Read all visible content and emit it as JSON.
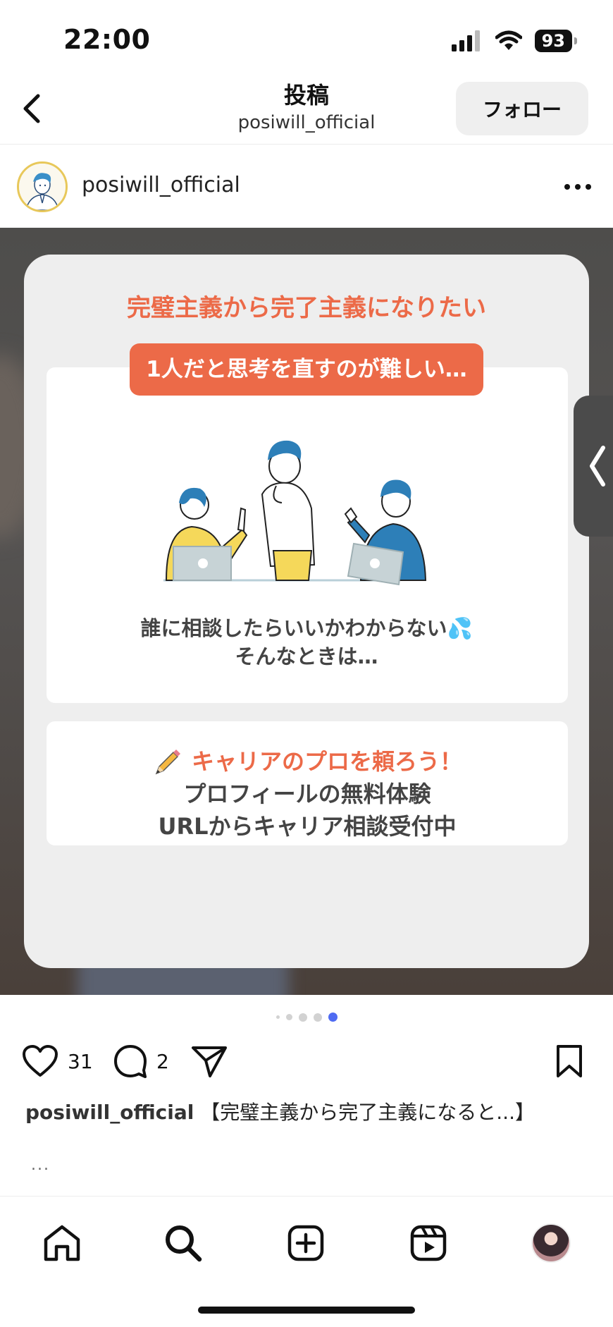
{
  "status_bar": {
    "time": "22:00",
    "battery": "93"
  },
  "header": {
    "title": "投稿",
    "subtitle": "posiwill_official",
    "follow_label": "フォロー"
  },
  "author": {
    "username": "posiwill_official"
  },
  "post": {
    "card_title": "完璧主義から完了主義になりたい",
    "pill_text": "1人だと思考を直すのが難しい…",
    "caption_line1": "誰に相談したらいいかわからない💦",
    "caption_line2": "そんなときは…",
    "cta_line1": "キャリアのプロを頼ろう！",
    "cta_line2": "プロフィールの無料体験",
    "cta_line3": "URLからキャリア相談受付中",
    "carousel_total": 5,
    "carousel_current": 5
  },
  "actions": {
    "likes": "31",
    "comments": "2"
  },
  "caption": {
    "username": "posiwill_official",
    "text": "【完璧主義から完了主義になると...】",
    "more": "..."
  },
  "colors": {
    "accent": "#ec6a48",
    "active_dot": "#4f6bf2"
  },
  "icons": [
    "back-icon",
    "more-icon",
    "heart-icon",
    "comment-icon",
    "share-icon",
    "bookmark-icon",
    "home-icon",
    "search-icon",
    "create-icon",
    "reels-icon",
    "profile-icon"
  ]
}
